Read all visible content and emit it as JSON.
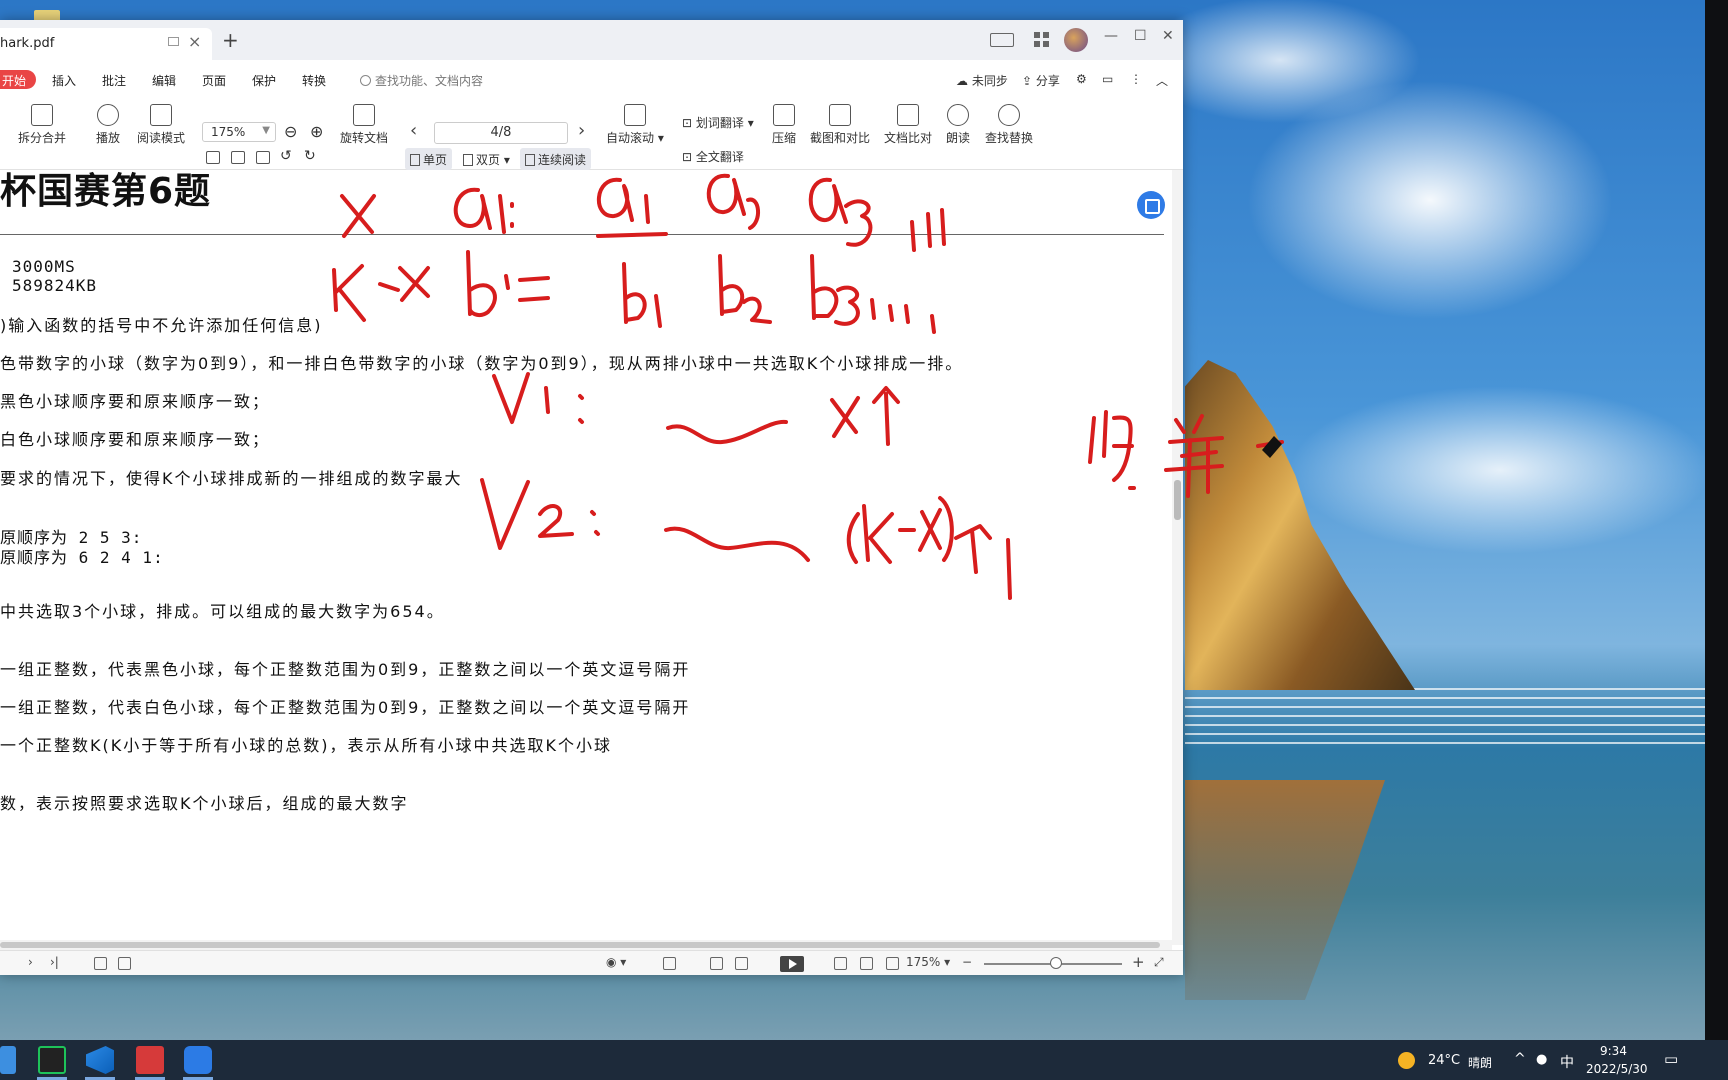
{
  "window": {
    "tab_title": "hark.pdf",
    "tab_add": "+",
    "tab_close": "×"
  },
  "titlebar_controls": {
    "minimize": "—",
    "maximize": "☐",
    "close": "✕"
  },
  "menu": {
    "start": "开始",
    "items": [
      "插入",
      "批注",
      "编辑",
      "页面",
      "保护",
      "转换"
    ],
    "search_placeholder": "查找功能、文档内容",
    "sync": "未同步",
    "share": "分享"
  },
  "toolbar": {
    "split_merge": "拆分合并",
    "play": "播放",
    "reading_mode": "阅读模式",
    "zoom": "175%",
    "rotate": "旋转文档",
    "page_indicator": "4/8",
    "single_page": "单页",
    "double_page": "双页",
    "continuous": "连续阅读",
    "auto_scroll": "自动滚动",
    "word_translate": "划词翻译",
    "full_translate": "全文翻译",
    "compress": "压缩",
    "screenshot_compare": "截图和对比",
    "doc_compare": "文档比对",
    "read_aloud": "朗读",
    "find_replace": "查找替换"
  },
  "document": {
    "heading": "杯国赛第6题",
    "lines": [
      {
        "text": "3000MS",
        "mono": true
      },
      {
        "text": "589824KB",
        "mono": true
      },
      {
        "text": ")输入函数的括号中不允许添加任何信息)",
        "mono": false
      },
      {
        "text": "色带数字的小球（数字为0到9），和一排白色带数字的小球（数字为0到9），现从两排小球中一共选取K个小球排成一排。",
        "mono": false
      },
      {
        "text": "黑色小球顺序要和原来顺序一致；",
        "mono": false
      },
      {
        "text": "白色小球顺序要和原来顺序一致；",
        "mono": false
      },
      {
        "text": "要求的情况下，使得K个小球排成新的一排组成的数字最大",
        "mono": false
      },
      {
        "text": "原顺序为 2 5 3:",
        "mono": false
      },
      {
        "text": "原顺序为 6 2 4 1:",
        "mono": false
      },
      {
        "text": "中共选取3个小球，排成。可以组成的最大数字为654。",
        "mono": false
      },
      {
        "text": "一组正整数，代表黑色小球，每个正整数范围为0到9，正整数之间以一个英文逗号隔开",
        "mono": false
      },
      {
        "text": "一组正整数，代表白色小球，每个正整数范围为0到9，正整数之间以一个英文逗号隔开",
        "mono": false
      },
      {
        "text": "一个正整数K(K小于等于所有小球的总数)，表示从所有小球中共选取K个小球",
        "mono": false
      },
      {
        "text": "数，表示按照要求选取K个小球后，组成的最大数字",
        "mono": false
      }
    ]
  },
  "statusbar": {
    "zoom": "175%",
    "zoom_minus": "−",
    "zoom_plus": "+"
  },
  "taskbar": {
    "weather_temp": "24°C",
    "weather_desc": "晴朗",
    "ime": "中",
    "time": "9:34",
    "date": "2022/5/30"
  },
  "colors": {
    "ink": "#d71d1d",
    "start_tab": "#e94545",
    "accent": "#2f7be6",
    "taskbar": "#1d2a3a"
  }
}
